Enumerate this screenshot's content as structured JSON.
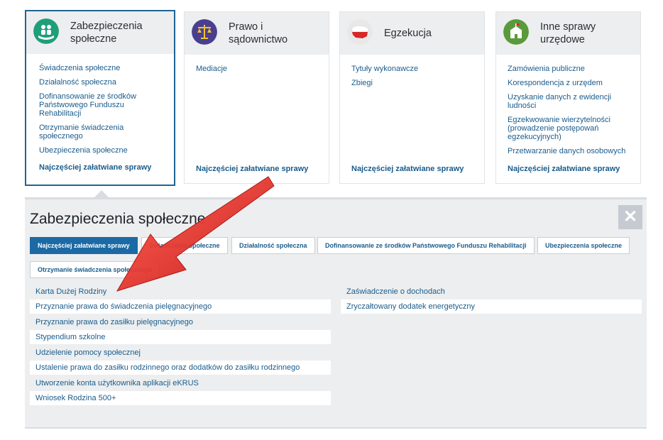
{
  "cards": [
    {
      "title": "Zabezpieczenia\nspołeczne",
      "icon": "hands-family-icon",
      "icon_bg": "#1f9e7a",
      "links": [
        "Świadczenia społeczne",
        "Działalność społeczna",
        "Dofinansowanie ze środków\nPaństwowego Funduszu\nRehabilitacji",
        "Otrzymanie świadczenia\nspołecznego",
        "Ubezpieczenia społeczne"
      ],
      "bottom": "Najczęściej załatwiane sprawy"
    },
    {
      "title": "Prawo i\nsądownictwo",
      "icon": "scales-icon",
      "icon_bg": "#4a3f8f",
      "links": [
        "Mediacje"
      ],
      "bottom": "Najczęściej załatwiane sprawy"
    },
    {
      "title": "Egzekucja",
      "icon": "poland-map-icon",
      "icon_bg": "#e8e8e8",
      "links": [
        "Tytuły wykonawcze",
        "Zbiegi"
      ],
      "bottom": "Najczęściej załatwiane sprawy"
    },
    {
      "title": "Inne sprawy\nurzędowe",
      "icon": "office-building-icon",
      "icon_bg": "#5a9a3a",
      "links": [
        "Zamówienia publiczne",
        "Korespondencja z urzędem",
        "Uzyskanie danych z ewidencji\nludności",
        "Egzekwowanie wierzytelności\n(prowadzenie postępowań\negzekucyjnych)",
        "Przetwarzanie danych osobowych"
      ],
      "bottom": "Najczęściej załatwiane sprawy"
    }
  ],
  "panel": {
    "title": "Zabezpieczenia społeczne",
    "close": "✕",
    "tabs": [
      "Najczęściej załatwiane sprawy",
      "Świadczenia społeczne",
      "Działalność społeczna",
      "Dofinansowanie ze środków Państwowego Funduszu Rehabilitacji",
      "Ubezpieczenia społeczne",
      "Otrzymanie świadczenia społecznego"
    ],
    "left_items": [
      "Karta Dużej Rodziny",
      "Przyznanie prawa do świadczenia pielęgnacyjnego",
      "Przyznanie prawa do zasiłku pielęgnacyjnego",
      "Stypendium szkolne",
      "Udzielenie pomocy społecznej",
      "Ustalenie prawa do zasiłku rodzinnego oraz dodatków do zasiłku rodzinnego",
      "Utworzenie konta użytkownika aplikacji eKRUS",
      "Wniosek Rodzina 500+"
    ],
    "right_items": [
      "Zaświadczenie o dochodach",
      "Zryczałtowany dodatek energetyczny"
    ]
  },
  "colors": {
    "accent": "#1b6aa5",
    "link": "#1a5c8c",
    "arrow": "#e02020"
  }
}
